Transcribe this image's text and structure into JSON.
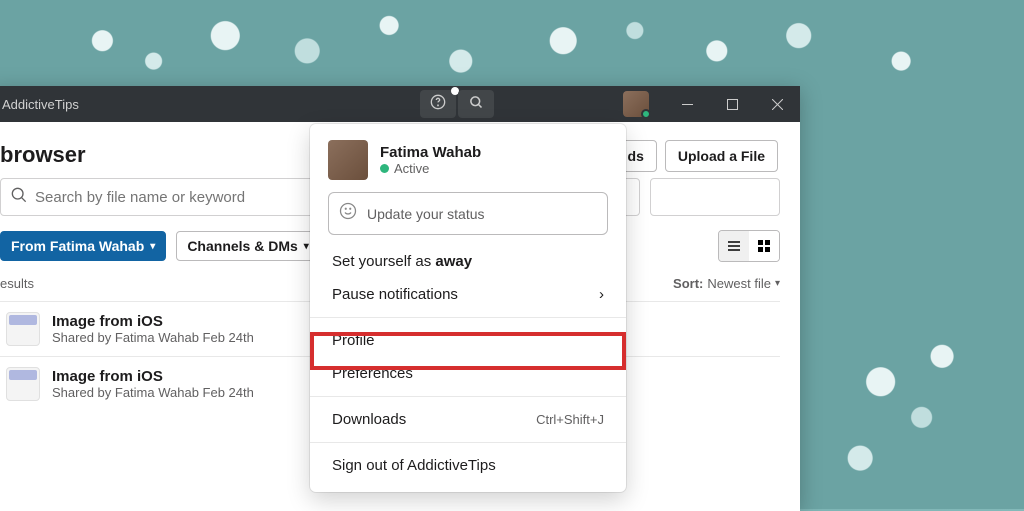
{
  "titlebar": {
    "title": "AddictiveTips"
  },
  "page": {
    "title": "browser"
  },
  "toolbar": {
    "btn_partial": "ds",
    "upload_label": "Upload a File"
  },
  "search": {
    "placeholder": "Search by file name or keyword"
  },
  "filters": {
    "from_label": "From Fatima Wahab",
    "channels_label": "Channels & DMs"
  },
  "results": {
    "header": "esults",
    "sort_label": "Sort:",
    "sort_value": "Newest file",
    "items": [
      {
        "title": "Image from iOS",
        "subtitle": "Shared by Fatima Wahab Feb 24th"
      },
      {
        "title": "Image from iOS",
        "subtitle": "Shared by Fatima Wahab Feb 24th"
      }
    ]
  },
  "profile_menu": {
    "name": "Fatima Wahab",
    "status": "Active",
    "status_placeholder": "Update your status",
    "set_away_prefix": "Set yourself as ",
    "set_away_bold": "away",
    "pause_notif": "Pause notifications",
    "profile": "Profile",
    "preferences": "Preferences",
    "downloads": "Downloads",
    "downloads_shortcut": "Ctrl+Shift+J",
    "sign_out": "Sign out of AddictiveTips"
  }
}
